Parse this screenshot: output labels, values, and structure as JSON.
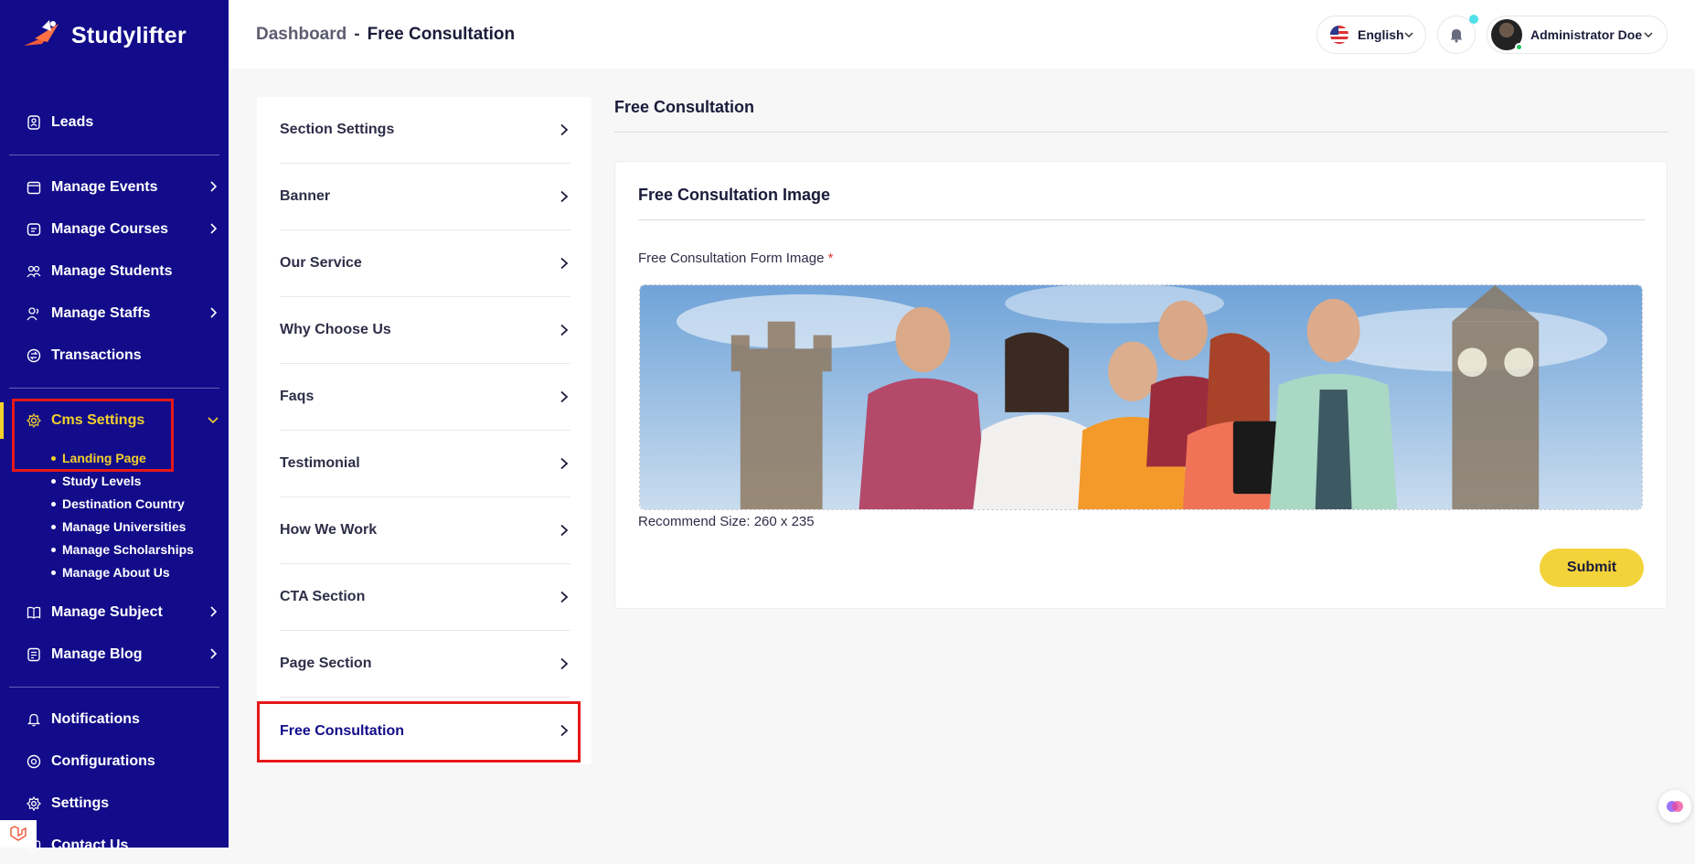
{
  "app": {
    "name": "Studylifter"
  },
  "sidebar": {
    "items": [
      {
        "label": "Leads",
        "icon": "leads-icon"
      },
      {
        "label": "Manage Events",
        "icon": "calendar-icon"
      },
      {
        "label": "Manage Courses",
        "icon": "courses-icon"
      },
      {
        "label": "Manage Students",
        "icon": "students-icon"
      },
      {
        "label": "Manage Staffs",
        "icon": "staffs-icon"
      },
      {
        "label": "Transactions",
        "icon": "transactions-icon"
      },
      {
        "label": "Cms Settings",
        "icon": "cms-settings-icon"
      },
      {
        "label": "Manage Subject",
        "icon": "book-icon"
      },
      {
        "label": "Manage Blog",
        "icon": "blog-icon"
      },
      {
        "label": "Notifications",
        "icon": "bell-icon"
      },
      {
        "label": "Configurations",
        "icon": "configurations-icon"
      },
      {
        "label": "Settings",
        "icon": "gear-icon"
      },
      {
        "label": "Contact Us",
        "icon": "contact-icon"
      }
    ],
    "cms_sub_items": [
      "Landing Page",
      "Study Levels",
      "Destination Country",
      "Manage Universities",
      "Manage Scholarships",
      "Manage About Us"
    ],
    "active_sub_item": "Landing Page"
  },
  "header": {
    "breadcrumb": {
      "parent": "Dashboard",
      "separator": "-",
      "current": "Free Consultation"
    },
    "language": "English",
    "user_name": "Administrator Doe"
  },
  "section_menu": {
    "items": [
      "Section Settings",
      "Banner",
      "Our Service",
      "Why Choose Us",
      "Faqs",
      "Testimonial",
      "How We Work",
      "CTA Section",
      "Page Section",
      "Free Consultation"
    ],
    "active": "Free Consultation"
  },
  "main": {
    "page_title": "Free Consultation",
    "card_title": "Free Consultation Image",
    "field_label": "Free Consultation Form Image",
    "required_mark": "*",
    "recommend_text": "Recommend Size: 260 x 235",
    "submit_label": "Submit"
  },
  "colors": {
    "sidebar_bg": "#120c8a",
    "accent_yellow": "#f3d33a",
    "highlight_red": "#e51919"
  }
}
